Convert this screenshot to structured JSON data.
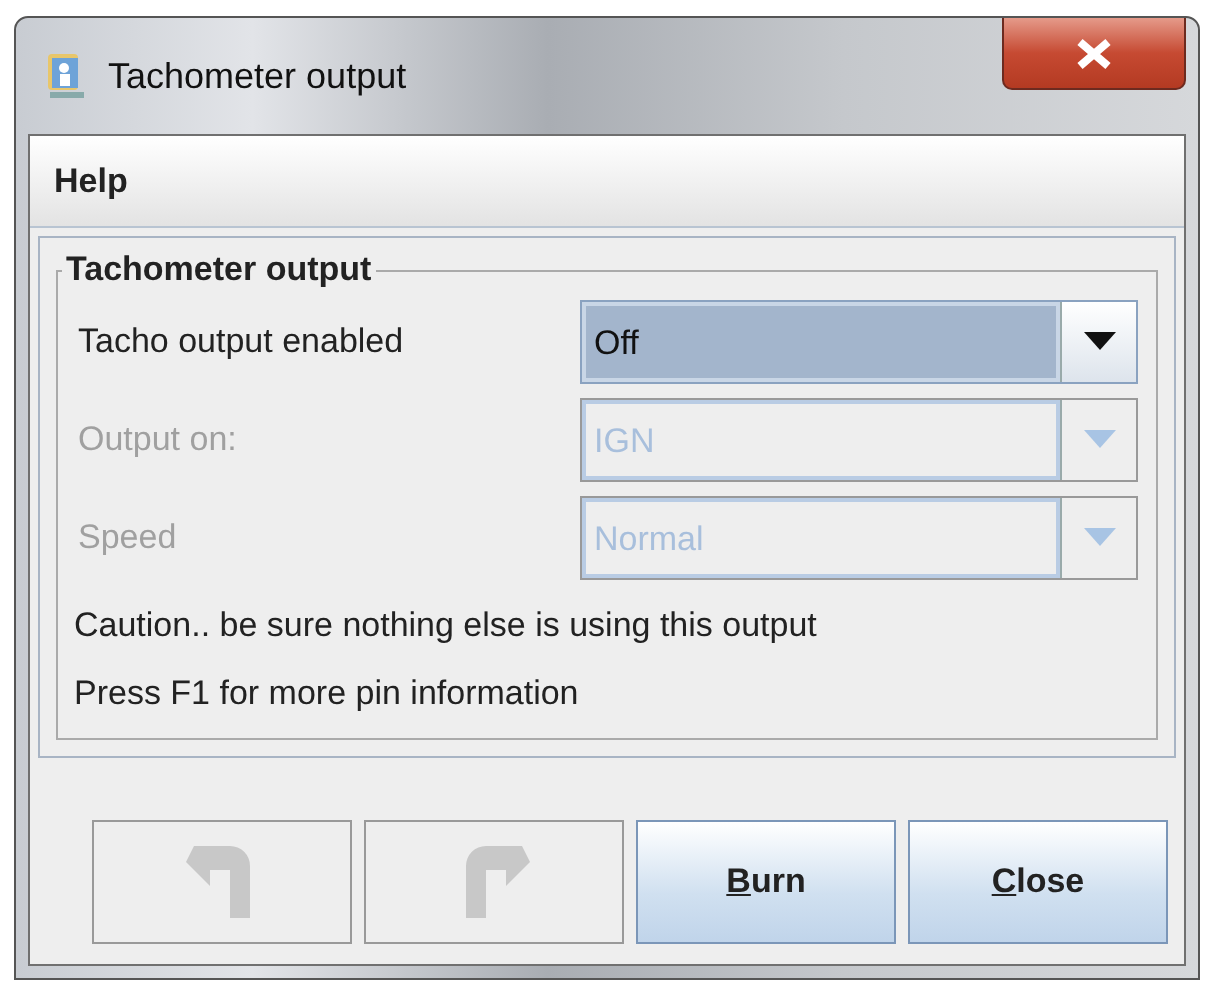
{
  "window": {
    "title": "Tachometer output"
  },
  "menu": [
    {
      "label": "Help"
    }
  ],
  "group": {
    "title": "Tachometer output",
    "fields": [
      {
        "label": "Tacho output enabled",
        "value": "Off",
        "disabled": false
      },
      {
        "label": "Output on:",
        "value": "IGN",
        "disabled": true
      },
      {
        "label": "Speed",
        "value": "Normal",
        "disabled": true
      }
    ],
    "notes": [
      "Caution.. be sure nothing else is using this output",
      "Press F1 for more pin information"
    ]
  },
  "buttons": [
    {
      "kind": "undo",
      "disabled": true
    },
    {
      "kind": "redo",
      "disabled": true
    },
    {
      "kind": "text",
      "label": "Burn",
      "mnemonic_underlined": true,
      "disabled": false
    },
    {
      "kind": "text",
      "label": "Close",
      "mnemonic_underlined": true,
      "disabled": false
    }
  ]
}
